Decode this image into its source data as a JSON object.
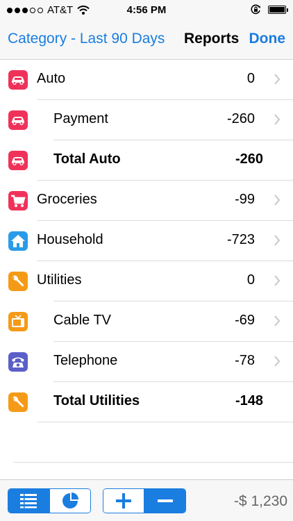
{
  "status": {
    "carrier": "AT&T",
    "time": "4:56 PM"
  },
  "nav": {
    "back_label": "Category - Last 90 Days",
    "title": "Reports",
    "done_label": "Done"
  },
  "rows": [
    {
      "label": "Auto",
      "value": "0",
      "icon": "car-icon"
    },
    {
      "label": "Payment",
      "value": "-260",
      "icon": "car-icon"
    },
    {
      "label": "Total Auto",
      "value": "-260",
      "icon": "car-icon"
    },
    {
      "label": "Groceries",
      "value": "-99",
      "icon": "cart-icon"
    },
    {
      "label": "Household",
      "value": "-723",
      "icon": "house-icon"
    },
    {
      "label": "Utilities",
      "value": "0",
      "icon": "wrench-icon"
    },
    {
      "label": "Cable TV",
      "value": "-69",
      "icon": "tv-icon"
    },
    {
      "label": "Telephone",
      "value": "-78",
      "icon": "telephone-icon"
    },
    {
      "label": "Total Utilities",
      "value": "-148",
      "icon": "wrench-icon"
    }
  ],
  "toolbar": {
    "total": "-$ 1,230"
  },
  "colors": {
    "accent": "#1a7de0",
    "auto": "#f0325a",
    "household": "#2a9be8",
    "utilities": "#f59a17",
    "telephone": "#5b5fc7"
  }
}
